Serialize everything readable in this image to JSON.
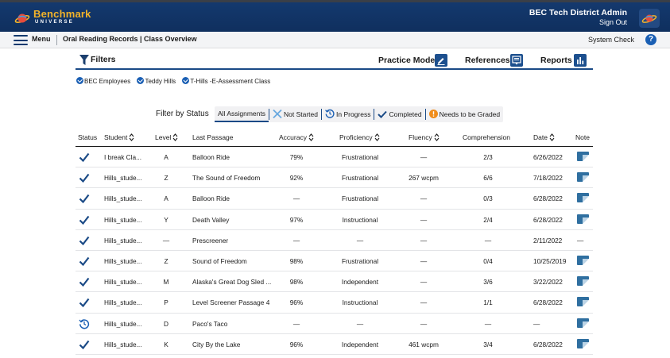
{
  "app": {
    "logo_text": "Benchmark",
    "logo_sub": "UNIVERSE",
    "admin_name": "BEC Tech District Admin",
    "sign_out": "Sign Out"
  },
  "subbar": {
    "menu_label": "Menu",
    "breadcrumb": "Oral Reading Records | Class Overview",
    "system_check": "System Check",
    "help": "?"
  },
  "toolbar": {
    "filters_label": "Filters",
    "practice_mode": "Practice Mode",
    "references": "References",
    "reports": "Reports"
  },
  "chips": [
    "BEC Employees",
    "Teddy Hills",
    "T-Hills -E-Assessment Class"
  ],
  "status_filter": {
    "label": "Filter by Status",
    "options": [
      "All Assignments",
      "Not Started",
      "In Progress",
      "Completed",
      "Needs to be Graded"
    ],
    "selected": "All Assignments"
  },
  "table": {
    "headers": {
      "status": "Status",
      "student": "Student",
      "level": "Level",
      "passage": "Last Passage",
      "accuracy": "Accuracy",
      "proficiency": "Proficiency",
      "fluency": "Fluency",
      "comprehension": "Comprehension",
      "date": "Date",
      "note": "Note"
    },
    "rows": [
      {
        "status": "completed",
        "student": "I break Cla...",
        "level": "A",
        "passage": "Balloon Ride",
        "accuracy": "79%",
        "proficiency": "Frustrational",
        "fluency": "—",
        "comprehension": "2/3",
        "date": "6/26/2022",
        "note": true
      },
      {
        "status": "completed",
        "student": "Hills_stude...",
        "level": "Z",
        "passage": "The Sound of Freedom",
        "accuracy": "92%",
        "proficiency": "Frustrational",
        "fluency": "267 wcpm",
        "comprehension": "6/6",
        "date": "7/18/2022",
        "note": true
      },
      {
        "status": "completed",
        "student": "Hills_stude...",
        "level": "A",
        "passage": "Balloon Ride",
        "accuracy": "—",
        "proficiency": "Frustrational",
        "fluency": "—",
        "comprehension": "0/3",
        "date": "6/28/2022",
        "note": true
      },
      {
        "status": "completed",
        "student": "Hills_stude...",
        "level": "Y",
        "passage": "Death Valley",
        "accuracy": "97%",
        "proficiency": "Instructional",
        "fluency": "—",
        "comprehension": "2/4",
        "date": "6/28/2022",
        "note": true
      },
      {
        "status": "completed",
        "student": "Hills_stude...",
        "level": "—",
        "passage": "Prescreener",
        "accuracy": "—",
        "proficiency": "—",
        "fluency": "—",
        "comprehension": "—",
        "date": "2/11/2022",
        "note": false,
        "note_text": "—"
      },
      {
        "status": "completed",
        "student": "Hills_stude...",
        "level": "Z",
        "passage": "Sound of Freedom",
        "accuracy": "98%",
        "proficiency": "Frustrational",
        "fluency": "—",
        "comprehension": "0/4",
        "date": "10/25/2019",
        "note": true
      },
      {
        "status": "completed",
        "student": "Hills_stude...",
        "level": "M",
        "passage": "Alaska's Great Dog Sled ...",
        "accuracy": "98%",
        "proficiency": "Independent",
        "fluency": "—",
        "comprehension": "3/6",
        "date": "3/22/2022",
        "note": true
      },
      {
        "status": "completed",
        "student": "Hills_stude...",
        "level": "P",
        "passage": "Level Screener Passage 4",
        "accuracy": "96%",
        "proficiency": "Instructional",
        "fluency": "—",
        "comprehension": "1/1",
        "date": "6/28/2022",
        "note": true
      },
      {
        "status": "in-progress",
        "student": "Hills_stude...",
        "level": "D",
        "passage": "Paco's Taco",
        "accuracy": "—",
        "proficiency": "—",
        "fluency": "—",
        "comprehension": "—",
        "date": "—",
        "note": true
      },
      {
        "status": "completed",
        "student": "Hills_stude...",
        "level": "K",
        "passage": "City By the Lake",
        "accuracy": "96%",
        "proficiency": "Independent",
        "fluency": "461 wcpm",
        "comprehension": "3/4",
        "date": "6/28/2022",
        "note": true
      }
    ]
  },
  "colors": {
    "header_bg": "#14396e",
    "accent": "#1a4a86",
    "check": "#1a5fb4",
    "needs_grading": "#f08c1a"
  }
}
